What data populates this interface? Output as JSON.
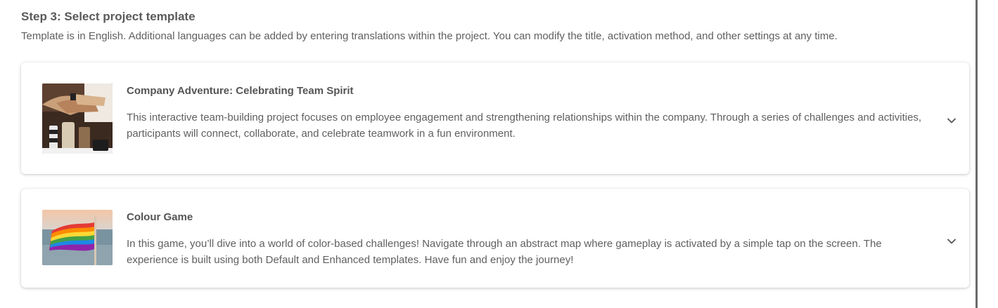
{
  "step": {
    "title": "Step 3: Select project template",
    "description": "Template is in English. Additional languages can be added by entering translations within the project. You can modify the title, activation method, and other settings at any time."
  },
  "templates": [
    {
      "title": "Company Adventure: Celebrating Team Spirit",
      "description": "This interactive team-building project focuses on employee engagement and strengthening relationships within the company. Through a series of challenges and activities, participants will connect, collaborate, and celebrate teamwork in a fun environment.",
      "thumbnail_icon": "team-hands-photo"
    },
    {
      "title": "Colour Game",
      "description": "In this game, you’ll dive into a world of color-based challenges! Navigate through an abstract map where gameplay is activated by a simple tap on the screen. The experience is built using both Default and Enhanced templates. Have fun and enjoy the journey!",
      "thumbnail_icon": "rainbow-flag-photo"
    }
  ],
  "expand_icon": "chevron-down-icon"
}
